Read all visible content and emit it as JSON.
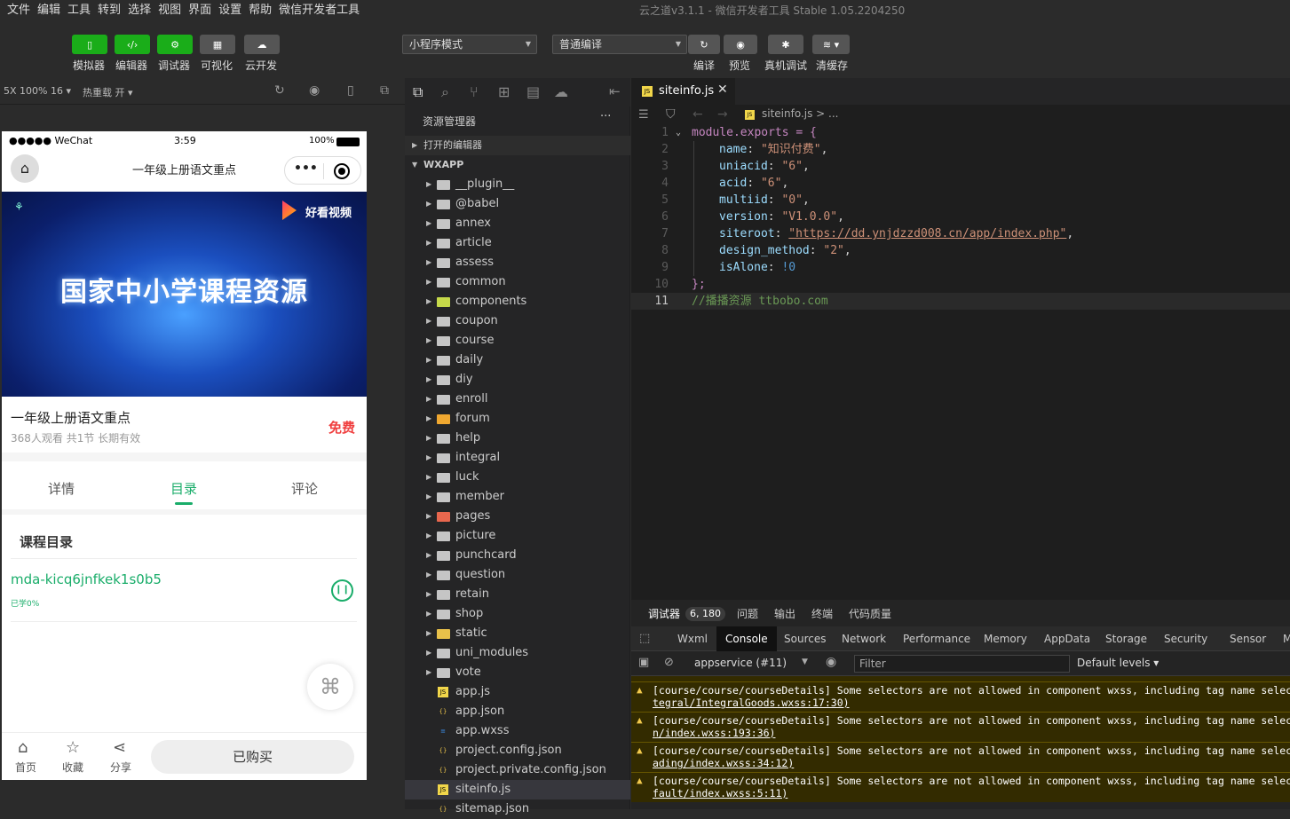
{
  "menu": [
    "文件",
    "编辑",
    "工具",
    "转到",
    "选择",
    "视图",
    "界面",
    "设置",
    "帮助",
    "微信开发者工具"
  ],
  "window_title": "云之道v3.1.1 - 微信开发者工具 Stable 1.05.2204250",
  "toolbar": {
    "simulator": "模拟器",
    "editor": "编辑器",
    "debugger": "调试器",
    "visual": "可视化",
    "cloud": "云开发",
    "mode": "小程序模式",
    "compile_mode": "普通编译",
    "compile": "编译",
    "preview": "预览",
    "real_debug": "真机调试",
    "clear_cache": "清缓存"
  },
  "simbar": {
    "zoom": "5X 100% 16 ▾",
    "hotreload": "热重载 开 ▾"
  },
  "phone": {
    "status_signal": "●●●●● WeChat",
    "time": "3:59",
    "battery": "100%",
    "nav_title": "一年级上册语文重点",
    "banner_logo": "好看视频",
    "banner_title": "国家中小学课程资源",
    "course_title": "一年级上册语文重点",
    "course_meta": "368人观看  共1节  长期有效",
    "price": "免费",
    "tabs": [
      "详情",
      "目录",
      "评论"
    ],
    "section_title": "课程目录",
    "lesson_title": "mda-kicq6jnfkek1s0b5",
    "lesson_progress": "已学0%",
    "bottom": {
      "home": "首页",
      "fav": "收藏",
      "share": "分享",
      "bought": "已购买"
    }
  },
  "explorer": {
    "title": "资源管理器",
    "open_editors": "打开的编辑器",
    "root": "WXAPP",
    "folders": [
      "__plugin__",
      "@babel",
      "annex",
      "article",
      "assess",
      "common",
      "components",
      "coupon",
      "course",
      "daily",
      "diy",
      "enroll",
      "forum",
      "help",
      "integral",
      "luck",
      "member",
      "pages",
      "picture",
      "punchcard",
      "question",
      "retain",
      "shop",
      "static",
      "uni_modules",
      "vote"
    ],
    "files": [
      "app.js",
      "app.json",
      "app.wxss",
      "project.config.json",
      "project.private.config.json",
      "siteinfo.js",
      "sitemap.json"
    ]
  },
  "editor": {
    "tab": "siteinfo.js",
    "breadcrumb": "siteinfo.js > ...",
    "lines": [
      {
        "n": "1",
        "k": "module.exports = {"
      },
      {
        "n": "2",
        "p": "name",
        "v": "\"知识付费\""
      },
      {
        "n": "3",
        "p": "uniacid",
        "v": "\"6\""
      },
      {
        "n": "4",
        "p": "acid",
        "v": "\"6\""
      },
      {
        "n": "5",
        "p": "multiid",
        "v": "\"0\""
      },
      {
        "n": "6",
        "p": "version",
        "v": "\"V1.0.0\""
      },
      {
        "n": "7",
        "p": "siteroot",
        "v": "\"https://dd.ynjdzzd008.cn/app/index.php\""
      },
      {
        "n": "8",
        "p": "design_method",
        "v": "\"2\""
      },
      {
        "n": "9",
        "p": "isAlone",
        "v": "!0"
      },
      {
        "n": "10",
        "k": "};"
      },
      {
        "n": "11",
        "c": "//播播资源 ttbobo.com"
      }
    ]
  },
  "devtools": {
    "tabs": [
      "调试器",
      "问题",
      "输出",
      "终端",
      "代码质量"
    ],
    "badge": "6, 180",
    "panels": [
      "Wxml",
      "Console",
      "Sources",
      "Network",
      "Performance",
      "Memory",
      "AppData",
      "Storage",
      "Security",
      "Sensor",
      "M"
    ],
    "context": "appservice (#11)",
    "filter": "Filter",
    "levels": "Default levels ▾",
    "logs": [
      {
        "a": "[course/course/courseDetails] Some selectors are not allowed in component wxss, including tag name selectors,",
        "b": "tegral/IntegralGoods.wxss:17:30)"
      },
      {
        "a": "[course/course/courseDetails] Some selectors are not allowed in component wxss, including tag name selectors,",
        "b": "n/index.wxss:193:36)"
      },
      {
        "a": "[course/course/courseDetails] Some selectors are not allowed in component wxss, including tag name selectors,",
        "b": "ading/index.wxss:34:12)"
      },
      {
        "a": "[course/course/courseDetails] Some selectors are not allowed in component wxss, including tag name selectors,",
        "b": "fault/index.wxss:5:11)"
      }
    ]
  }
}
